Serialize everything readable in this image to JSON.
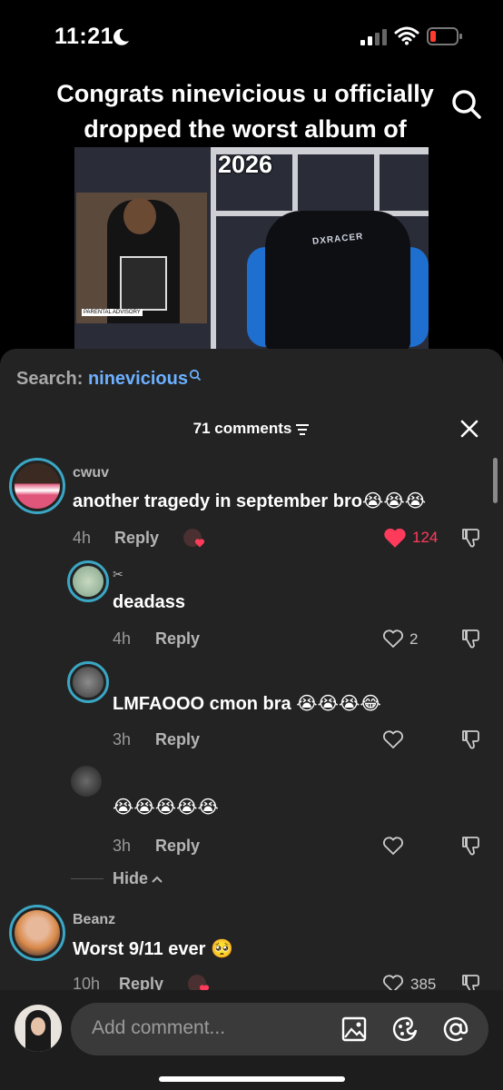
{
  "status_bar": {
    "time": "11:21"
  },
  "video": {
    "caption": "Congrats ninevicious u officially dropped the worst album of 2026",
    "chair_brand": "DXRACER",
    "album_badge": "PARENTAL ADVISORY"
  },
  "comments_panel": {
    "search_label": "Search: ",
    "search_term": "ninevicious",
    "count_label": "71 comments",
    "comments": [
      {
        "user": "cwuv",
        "text": "another tragedy in september bro",
        "emoji": "😭😭😭",
        "time": "4h",
        "reply": "Reply",
        "likes": "124"
      },
      {
        "user": "✂",
        "text": "deadass",
        "emoji": "",
        "time": "4h",
        "reply": "Reply",
        "likes": "2"
      },
      {
        "user": "",
        "text": "LMFAOOO cmon bra ",
        "emoji": "😭😭😭😂",
        "time": "3h",
        "reply": "Reply",
        "likes": ""
      },
      {
        "user": "",
        "text": "",
        "emoji": "😭😭😭😭😭",
        "time": "3h",
        "reply": "Reply",
        "likes": ""
      },
      {
        "user": "Beanz",
        "text": "Worst 9/11 ever ",
        "emoji": "🥺",
        "time": "10h",
        "reply": "Reply",
        "likes": "385"
      }
    ],
    "hide_label": "Hide"
  },
  "composer": {
    "placeholder": "Add comment..."
  },
  "colors": {
    "accent_blue": "#6cb0ff",
    "like_red": "#ff3b5c",
    "ring": "#3aa7c5"
  }
}
